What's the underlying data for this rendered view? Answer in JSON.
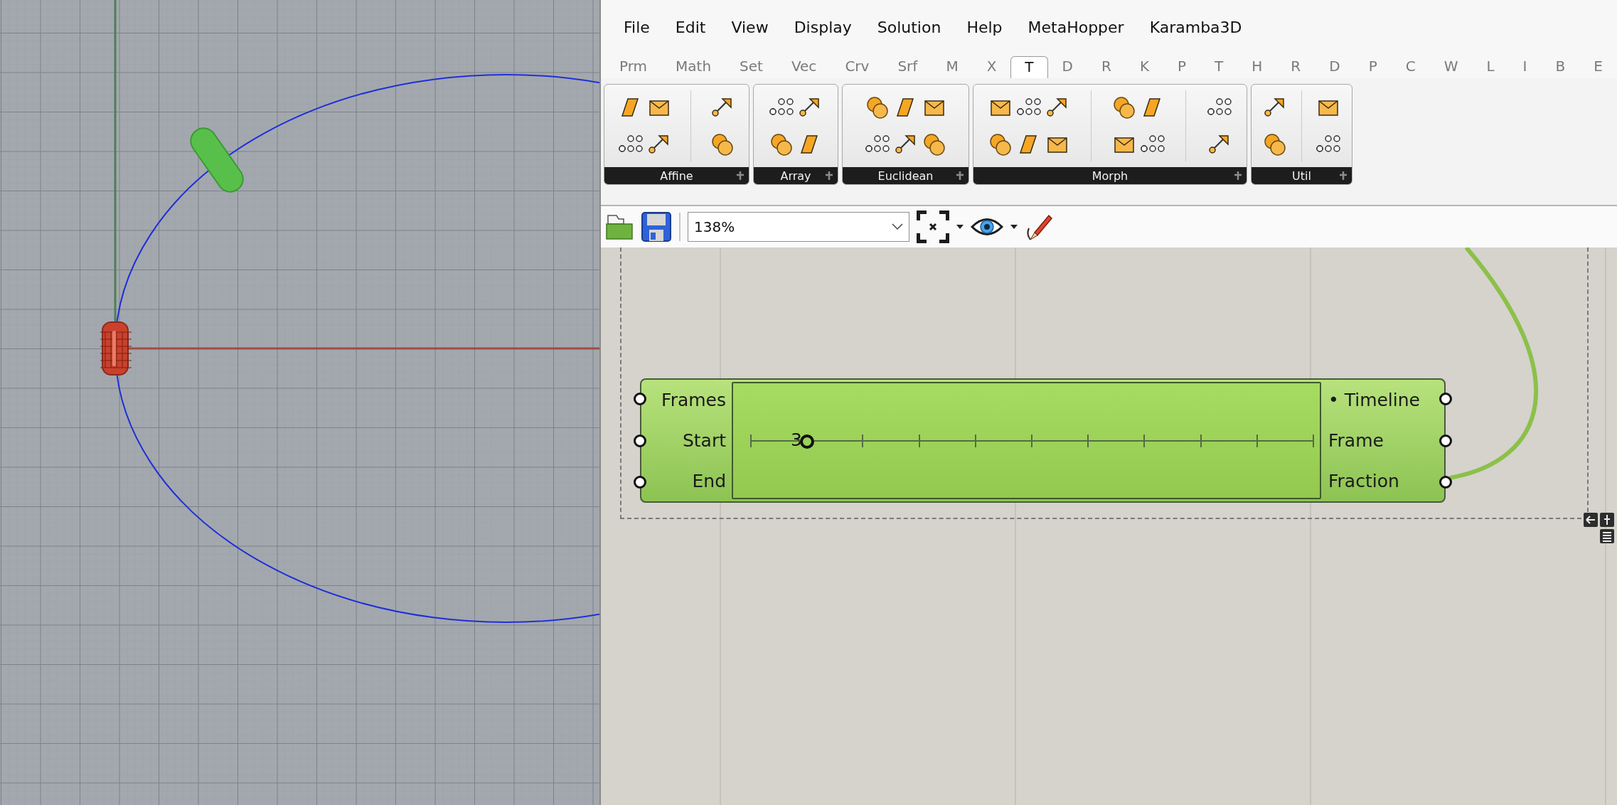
{
  "menu": [
    "File",
    "Edit",
    "View",
    "Display",
    "Solution",
    "Help",
    "MetaHopper",
    "Karamba3D"
  ],
  "tabs": [
    {
      "label": "Prm",
      "selected": false
    },
    {
      "label": "Math",
      "selected": false
    },
    {
      "label": "Set",
      "selected": false
    },
    {
      "label": "Vec",
      "selected": false
    },
    {
      "label": "Crv",
      "selected": false
    },
    {
      "label": "Srf",
      "selected": false
    },
    {
      "label": "M",
      "selected": false
    },
    {
      "label": "X",
      "selected": false
    },
    {
      "label": "T",
      "selected": true
    },
    {
      "label": "D",
      "selected": false
    },
    {
      "label": "R",
      "selected": false
    },
    {
      "label": "K",
      "selected": false
    },
    {
      "label": "P",
      "selected": false
    },
    {
      "label": "T",
      "selected": false
    },
    {
      "label": "H",
      "selected": false
    },
    {
      "label": "R",
      "selected": false
    },
    {
      "label": "D",
      "selected": false
    },
    {
      "label": "P",
      "selected": false
    },
    {
      "label": "C",
      "selected": false
    },
    {
      "label": "W",
      "selected": false
    },
    {
      "label": "L",
      "selected": false
    },
    {
      "label": "I",
      "selected": false
    },
    {
      "label": "B",
      "selected": false
    },
    {
      "label": "E",
      "selected": false
    }
  ],
  "ribbon_groups": [
    {
      "label": "Affine"
    },
    {
      "label": "Array"
    },
    {
      "label": "Euclidean"
    },
    {
      "label": "Morph"
    },
    {
      "label": "Util"
    }
  ],
  "toolbar": {
    "zoom": "138%"
  },
  "component": {
    "inputs": [
      "Frames",
      "Start",
      "End"
    ],
    "outputs": [
      "• Timeline",
      "Frame",
      "Fraction"
    ],
    "slider": {
      "reading": "3",
      "level": 0.1
    }
  }
}
